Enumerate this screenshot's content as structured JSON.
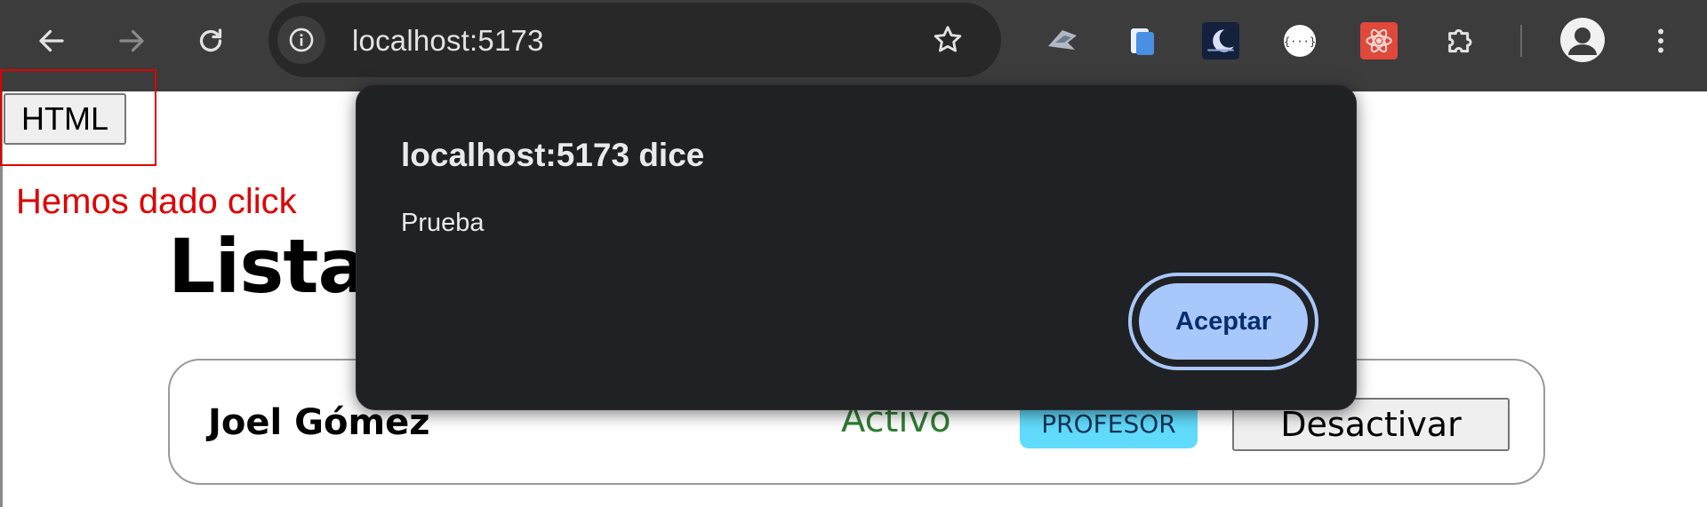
{
  "browser": {
    "url": "localhost:5173",
    "icons": {
      "back": "arrow-left-icon",
      "forward": "arrow-right-icon",
      "reload": "reload-icon",
      "site_info": "info-icon",
      "bookmark": "star-icon",
      "extensions": "puzzle-icon",
      "profile": "person-icon",
      "menu": "kebab-menu-icon"
    }
  },
  "page": {
    "html_button_label": "HTML",
    "clicked_message": "Hemos dado click",
    "title_visible": "Listac",
    "user": {
      "name": "Joel Gómez",
      "status": "Activo",
      "role": "PROFESOR",
      "action_label": "Desactivar"
    }
  },
  "dialog": {
    "title": "localhost:5173 dice",
    "message": "Prueba",
    "ok_label": "Aceptar"
  },
  "colors": {
    "toolbar": "#3c3c3c",
    "omnibox": "#282828",
    "dialog_bg": "#202124",
    "dialog_button": "#a8c7fa",
    "highlight": "#e00000",
    "status_active": "#2e7d32",
    "role_badge": "#61dbfb"
  }
}
